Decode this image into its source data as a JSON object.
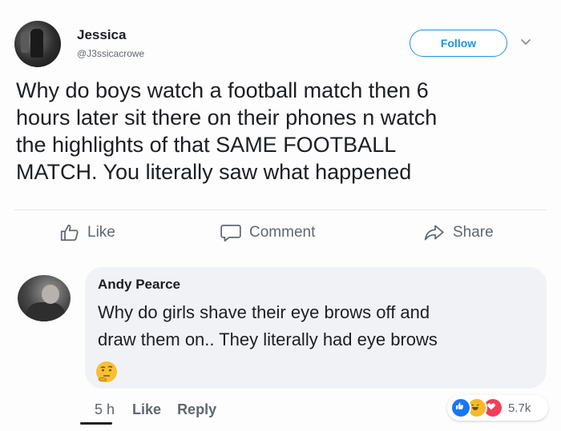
{
  "post": {
    "author_name": "Jessica",
    "author_handle": "@J3ssicacrowe",
    "follow_label": "Follow",
    "text_lines": [
      "Why do boys watch a football match then 6",
      "hours later sit there on their phones n watch",
      "the highlights of that SAME FOOTBALL",
      "MATCH. You literally saw what happened"
    ]
  },
  "actions": {
    "like_label": "Like",
    "comment_label": "Comment",
    "share_label": "Share",
    "icons": [
      "like-thumb-icon",
      "comment-bubble-icon",
      "share-arrow-icon"
    ]
  },
  "comment": {
    "author_name": "Andy Pearce",
    "text_lines": [
      "Why do girls shave their eye brows off and",
      "draw them on.. They literally had eye brows"
    ],
    "emoji": "thinking-face-icon",
    "time": "5 h",
    "like_label": "Like",
    "reply_label": "Reply",
    "reactions": [
      "like-reaction-icon",
      "haha-reaction-icon",
      "love-reaction-icon"
    ],
    "reaction_count": "5.7k"
  },
  "colors": {
    "accent": "#1b95e0",
    "secondary_text": "#606770",
    "bubble": "#f0f2f5"
  }
}
